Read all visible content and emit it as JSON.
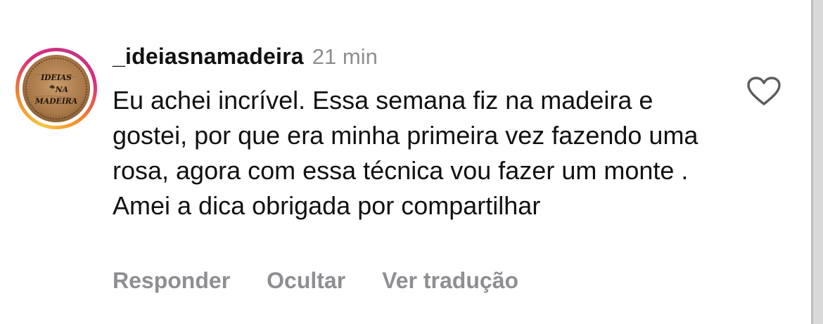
{
  "comment": {
    "username": "_ideiasnamadeira",
    "time": "21 min",
    "text": "Eu achei incrível. Essa semana fiz na madeira e gostei, por que era minha primeira vez fazendo uma rosa, agora com essa técnica vou fazer um monte . Amei a dica obrigada por compartilhar",
    "avatar_logo_text": [
      "IDEIAS",
      "NA",
      "MADEIRA"
    ],
    "like_icon": "heart-outline-icon"
  },
  "actions": {
    "reply": "Responder",
    "hide": "Ocultar",
    "translate": "Ver tradução"
  },
  "colors": {
    "text": "#111111",
    "muted": "#8e8e93",
    "story_ring": [
      "#f5c842",
      "#f58529",
      "#dd2a7b",
      "#c13584"
    ],
    "avatar_wood": "#b4865a"
  }
}
